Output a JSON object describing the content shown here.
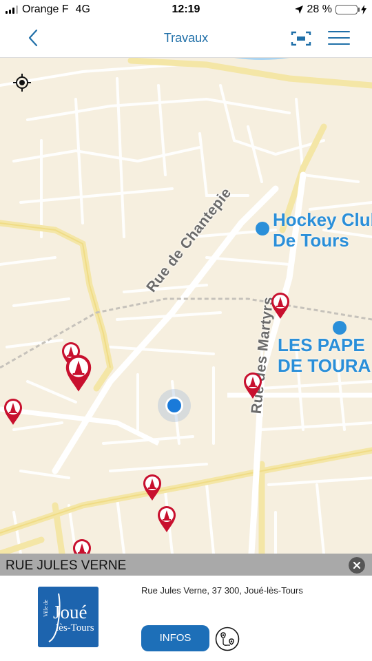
{
  "status_bar": {
    "carrier": "Orange F",
    "network": "4G",
    "time": "12:19",
    "battery_percent_text": "28 %",
    "battery_level": 0.28,
    "icons": [
      "signal-icon",
      "location-arrow-icon",
      "battery-icon",
      "charging-bolt-icon"
    ]
  },
  "nav": {
    "title": "Travaux",
    "back_icon": "chevron-left-icon",
    "scan_icon": "scan-icon",
    "menu_icon": "hamburger-menu-icon"
  },
  "map": {
    "locate_icon": "locate-crosshair-icon",
    "streets": [
      "Rue de Chantepie",
      "Rue des Martyrs"
    ],
    "pois": [
      {
        "line1": "Hockey Club",
        "line2": "De Tours"
      },
      {
        "line1": "LES PAPE",
        "line2": "DE TOURA"
      }
    ],
    "pin_icon": "roadwork-cone-icon",
    "pin_count": 9
  },
  "selection": {
    "title": "RUE JULES VERNE",
    "close_icon": "close-icon",
    "address": "Rue Jules Verne, 37 300, Joué-lès-Tours",
    "logo": {
      "small": "Ville de",
      "main": "Joué",
      "sub": "lès-Tours"
    },
    "infos_label": "INFOS",
    "route_icon": "route-icon"
  },
  "colors": {
    "accent": "#1f6fa8",
    "map_background": "#f6efdf",
    "pin_red": "#c8102e",
    "poi_blue": "#2a8fd9",
    "user_dot": "#1a7ad9",
    "info_header": "#a9a9a9"
  }
}
